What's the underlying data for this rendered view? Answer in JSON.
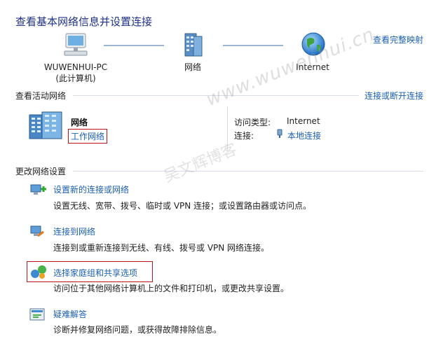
{
  "header": {
    "title": "查看基本网络信息并设置连接",
    "map_link": "查看完整映射"
  },
  "network_map": {
    "computer": {
      "name": "WUWENHUI-PC",
      "sub": "(此计算机)"
    },
    "network": {
      "name": "网络"
    },
    "internet": {
      "name": "Internet"
    }
  },
  "active_networks": {
    "heading": "查看活动网络",
    "action_link": "连接或断开连接",
    "network_name": "网络",
    "network_type": "工作网络",
    "access_type_label": "访问类型:",
    "access_type_value": "Internet",
    "connection_label": "连接:",
    "connection_value": "本地连接"
  },
  "change_settings": {
    "heading": "更改网络设置",
    "tasks": [
      {
        "title": "设置新的连接或网络",
        "desc": "设置无线、宽带、拨号、临时或 VPN 连接；或设置路由器或访问点。"
      },
      {
        "title": "连接到网络",
        "desc": "连接到或重新连接到无线、有线、拨号或 VPN 网络连接。"
      },
      {
        "title": "选择家庭组和共享选项",
        "desc": "访问位于其他网络计算机上的文件和打印机，或更改共享设置。"
      },
      {
        "title": "疑难解答",
        "desc": "诊断并修复网络问题，或获得故障排除信息。"
      }
    ]
  },
  "watermark": {
    "text": "www.wuwenhui.cn",
    "text2": "吴文辉博客"
  },
  "colors": {
    "link": "#1b5fb2",
    "title": "#1e3287",
    "highlight_box": "#c0121b"
  }
}
